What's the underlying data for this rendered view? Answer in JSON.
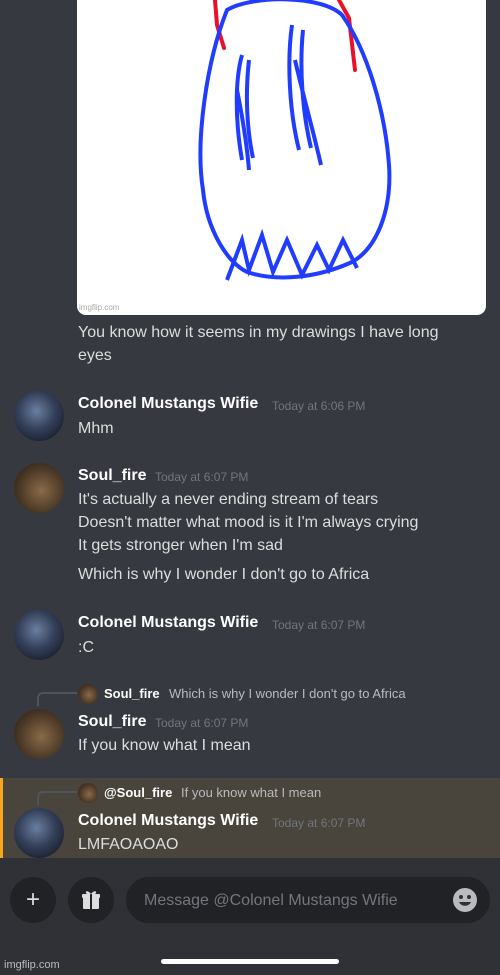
{
  "image_attachment": {
    "watermark": "imgflip.com"
  },
  "messages": [
    {
      "id": "m0",
      "lines": [
        "You know how it seems in my drawings I have long",
        "eyes"
      ]
    },
    {
      "id": "m1",
      "username": "Colonel Mustangs Wifie",
      "timestamp": "Today at 6:06 PM",
      "lines": [
        "Mhm"
      ]
    },
    {
      "id": "m2",
      "username": "Soul_fire",
      "timestamp": "Today at 6:07 PM",
      "lines": [
        "It's actually a never ending stream of tears",
        "Doesn't matter what mood is it I'm always crying",
        "It gets stronger when I'm sad",
        "Which is why I wonder I don't go to Africa"
      ]
    },
    {
      "id": "m3",
      "username": "Colonel Mustangs Wifie",
      "timestamp": "Today at 6:07 PM",
      "lines": [
        ":C"
      ]
    },
    {
      "id": "m4",
      "reply": {
        "username": "Soul_fire",
        "text": "Which is why I wonder I don't go to Africa"
      },
      "username": "Soul_fire",
      "timestamp": "Today at 6:07 PM",
      "lines": [
        "If you know what I mean"
      ]
    },
    {
      "id": "m5",
      "reply": {
        "username": "@Soul_fire",
        "text": "If you know what I mean"
      },
      "username": "Colonel Mustangs Wifie",
      "timestamp": "Today at 6:07 PM",
      "lines": [
        "LMFAOAOAO"
      ],
      "mentioned": true
    }
  ],
  "composer": {
    "placeholder": "Message @Colonel Mustangs Wifie"
  },
  "icons": {
    "add": "plus-icon",
    "gift": "gift-icon",
    "emoji": "emoji-icon"
  },
  "colors": {
    "background": "#36393f",
    "mention_highlight": "#49443c",
    "mention_bar": "#faa61a",
    "drawing_blue": "#1f3cff",
    "drawing_red": "#e8102a"
  },
  "watermark": "imgflip.com"
}
